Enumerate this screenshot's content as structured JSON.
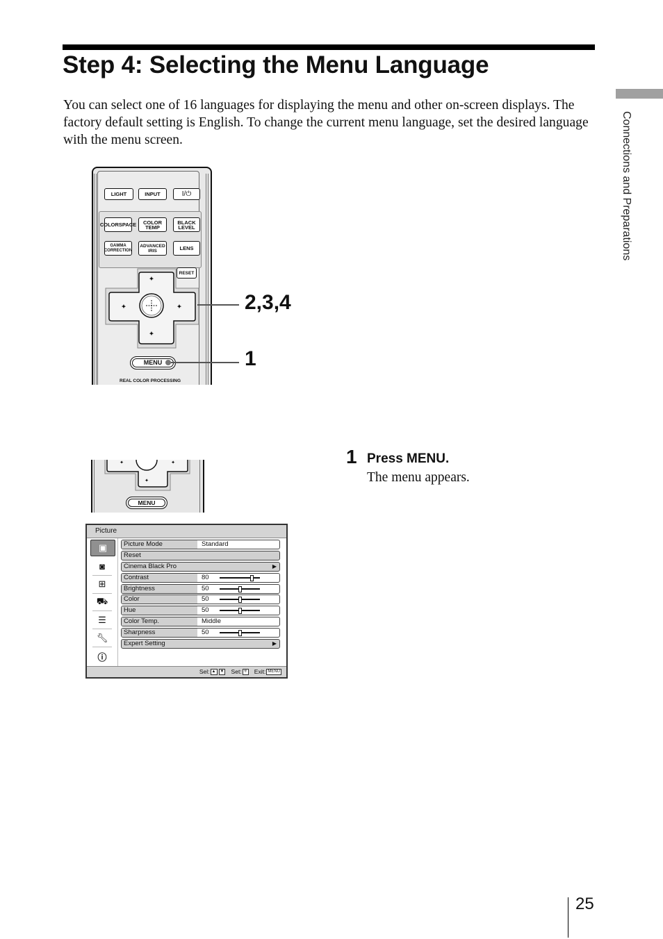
{
  "page": {
    "title": "Step 4: Selecting the Menu Language",
    "intro": "You can select one of 16 languages for displaying the menu and other on-screen displays. The factory default setting is English. To change the current menu language, set the desired language with the menu screen.",
    "side_section": "Connections and Preparations",
    "page_number": "25"
  },
  "remote": {
    "buttons_row1": [
      "LIGHT",
      "INPUT",
      "I/⏻"
    ],
    "buttons_row2": [
      [
        "COLOR",
        "SPACE"
      ],
      [
        "COLOR",
        "TEMP"
      ],
      [
        "BLACK",
        "LEVEL"
      ]
    ],
    "buttons_row3": [
      [
        "GAMMA",
        "CORRECTION"
      ],
      [
        "ADVANCED",
        "IRIS"
      ],
      [
        "LENS"
      ]
    ],
    "reset_label": "RESET",
    "menu_label": "MENU",
    "bottom_label": "REAL COLOR PROCESSING",
    "callout_dpad": "2,3,4",
    "callout_menu": "1"
  },
  "step1": {
    "number": "1",
    "title": "Press MENU.",
    "description": "The menu appears.",
    "remote_menu_label": "MENU"
  },
  "menu_screen": {
    "header": "Picture",
    "icons": [
      "picture-icon",
      "picture-plus-icon",
      "screen-icon",
      "setup-icon",
      "function-icon",
      "installation-icon",
      "information-icon"
    ],
    "rows": [
      {
        "label": "Picture Mode",
        "value": "Standard"
      },
      {
        "label": "Reset"
      },
      {
        "label": "Cinema Black Pro",
        "submenu": true
      },
      {
        "label": "Contrast",
        "value": "80",
        "slider": 0.8
      },
      {
        "label": "Brightness",
        "value": "50",
        "slider": 0.5
      },
      {
        "label": "Color",
        "value": "50",
        "slider": 0.5
      },
      {
        "label": "Hue",
        "value": "50",
        "slider": 0.5
      },
      {
        "label": "Color Temp.",
        "value": "Middle"
      },
      {
        "label": "Sharpness",
        "value": "50",
        "slider": 0.5
      },
      {
        "label": "Expert Setting",
        "submenu": true
      }
    ],
    "footer": {
      "sel": "Sel:",
      "set": "Set:",
      "exit": "Exit:",
      "exit_key": "MENU"
    }
  }
}
